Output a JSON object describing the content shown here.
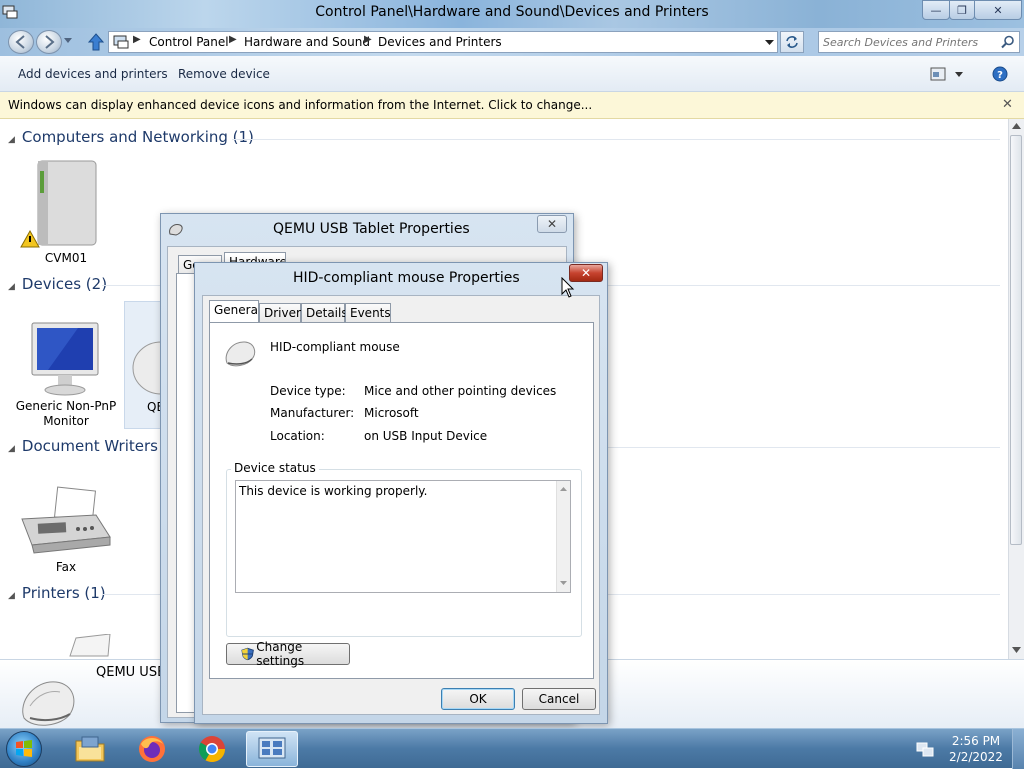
{
  "window": {
    "title": "Control Panel\\Hardware and Sound\\Devices and Printers",
    "minimize": "—",
    "restore": "❐",
    "close": "✕"
  },
  "address": {
    "crumbs": [
      "Control Panel",
      "Hardware and Sound",
      "Devices and Printers"
    ],
    "search_placeholder": "Search Devices and Printers"
  },
  "commands": {
    "add_devices": "Add devices and printers",
    "remove_device": "Remove device"
  },
  "infobar": {
    "text": "Windows can display enhanced device icons and information from the Internet. Click to change...",
    "close": "✕"
  },
  "groups": {
    "computers": "Computers and Networking (1)",
    "devices": "Devices (2)",
    "document_writers": "Document Writers an",
    "printers": "Printers (1)"
  },
  "items": {
    "cvm01": "CVM01",
    "monitor": "Generic Non-PnP Monitor",
    "tablet_partial": "QE",
    "fax": "Fax"
  },
  "details": {
    "device_name": "QEMU USB"
  },
  "tablet_dialog": {
    "title": "QEMU USB Tablet Properties",
    "tab_general": "General",
    "tab_hardware": "Hardware",
    "close": "✕"
  },
  "mouse_dialog": {
    "title": "HID-compliant mouse Properties",
    "close": "✕",
    "tabs": [
      "General",
      "Driver",
      "Details",
      "Events"
    ],
    "device_name": "HID-compliant mouse",
    "device_type_label": "Device type:",
    "device_type_value": "Mice and other pointing devices",
    "manufacturer_label": "Manufacturer:",
    "manufacturer_value": "Microsoft",
    "location_label": "Location:",
    "location_value": "on USB Input Device",
    "status_group": "Device status",
    "status_text": "This device is working properly.",
    "change_settings": "Change settings",
    "ok": "OK",
    "cancel": "Cancel"
  },
  "taskbar": {
    "time": "2:56 PM",
    "date": "2/2/2022"
  }
}
